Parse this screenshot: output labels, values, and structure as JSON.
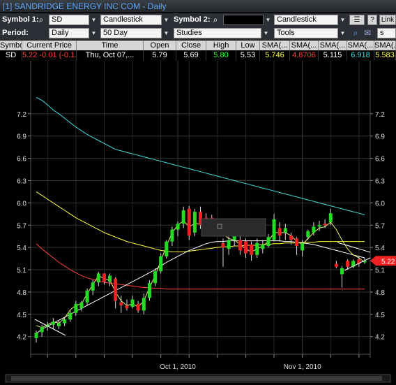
{
  "window": {
    "title": "[1] SANDRIDGE ENERGY INC   COM - Daily"
  },
  "toolbar": {
    "symbol1_label": "Symbol 1:",
    "symbol1_value": "SD",
    "chart_type1": "Candlestick",
    "symbol2_label": "Symbol 2:",
    "symbol2_value": "",
    "chart_type2": "Candlestick",
    "help_label": "?",
    "link_label": "Link",
    "period_label": "Period:",
    "period_value": "Daily",
    "range_value": "50 Day",
    "studies_value": "Studies",
    "tools_value": "Tools",
    "zoom_value": "s"
  },
  "quote": {
    "headers": [
      "Symbol",
      "Current Price",
      "Time",
      "Open",
      "Close",
      "High",
      "Low",
      "SMA(...",
      "SMA(...",
      "SMA(...",
      "SMA(...",
      "SMA(..."
    ],
    "values": [
      "SD",
      "5.22  -0.01  (-0.1...",
      "Thu, Oct 07,...",
      "5.79",
      "5.69",
      "5.80",
      "5.53",
      "5.746",
      "4.8706",
      "5.115",
      "6.918",
      "5.583"
    ],
    "colors": [
      "#ffffff",
      "#ff4040",
      "#ffffff",
      "#ffffff",
      "#ffffff",
      "#30ff30",
      "#ffffff",
      "#ffff40",
      "#ff4040",
      "#ffffff",
      "#40e0e0",
      "#ffff40"
    ]
  },
  "chart_data": {
    "type": "candlestick",
    "y_ticks": [
      "7.2",
      "6.9",
      "6.6",
      "6.3",
      "6.0",
      "5.7",
      "5.4",
      "5.1",
      "4.8",
      "4.5",
      "4.2"
    ],
    "ylim": [
      4.0,
      7.48
    ],
    "x_labels": [
      "Oct 1, 2010",
      "Nov 1, 2010"
    ],
    "x_label_index": [
      25,
      47
    ],
    "price_tag": "5.22",
    "candles": [
      {
        "o": 4.18,
        "h": 4.28,
        "l": 4.12,
        "c": 4.25
      },
      {
        "o": 4.26,
        "h": 4.36,
        "l": 4.2,
        "c": 4.33
      },
      {
        "o": 4.33,
        "h": 4.4,
        "l": 4.28,
        "c": 4.36
      },
      {
        "o": 4.36,
        "h": 4.45,
        "l": 4.3,
        "c": 4.4
      },
      {
        "o": 4.34,
        "h": 4.42,
        "l": 4.3,
        "c": 4.38
      },
      {
        "o": 4.38,
        "h": 4.46,
        "l": 4.34,
        "c": 4.43
      },
      {
        "o": 4.43,
        "h": 4.55,
        "l": 4.4,
        "c": 4.52
      },
      {
        "o": 4.52,
        "h": 4.68,
        "l": 4.48,
        "c": 4.64
      },
      {
        "o": 4.58,
        "h": 4.68,
        "l": 4.54,
        "c": 4.66
      },
      {
        "o": 4.66,
        "h": 4.85,
        "l": 4.62,
        "c": 4.82
      },
      {
        "o": 4.82,
        "h": 4.96,
        "l": 4.76,
        "c": 4.93
      },
      {
        "o": 4.93,
        "h": 5.07,
        "l": 4.88,
        "c": 5.05
      },
      {
        "o": 5.05,
        "h": 4.98,
        "l": 4.9,
        "c": 4.94
      },
      {
        "o": 4.94,
        "h": 5.05,
        "l": 4.88,
        "c": 5.02
      },
      {
        "o": 4.98,
        "h": 5.0,
        "l": 4.58,
        "c": 4.68
      },
      {
        "o": 4.66,
        "h": 4.75,
        "l": 4.52,
        "c": 4.62
      },
      {
        "o": 4.62,
        "h": 4.7,
        "l": 4.55,
        "c": 4.58
      },
      {
        "o": 4.6,
        "h": 4.75,
        "l": 4.58,
        "c": 4.7
      },
      {
        "o": 4.64,
        "h": 4.68,
        "l": 4.52,
        "c": 4.55
      },
      {
        "o": 4.55,
        "h": 4.78,
        "l": 4.5,
        "c": 4.72
      },
      {
        "o": 4.72,
        "h": 4.96,
        "l": 4.68,
        "c": 4.92
      },
      {
        "o": 4.92,
        "h": 5.12,
        "l": 4.88,
        "c": 5.08
      },
      {
        "o": 5.08,
        "h": 5.32,
        "l": 5.05,
        "c": 5.28
      },
      {
        "o": 5.28,
        "h": 5.5,
        "l": 5.25,
        "c": 5.48
      },
      {
        "o": 5.48,
        "h": 5.68,
        "l": 5.42,
        "c": 5.64
      },
      {
        "o": 5.64,
        "h": 5.75,
        "l": 5.55,
        "c": 5.72
      },
      {
        "o": 5.72,
        "h": 5.95,
        "l": 5.66,
        "c": 5.9
      },
      {
        "o": 5.92,
        "h": 5.96,
        "l": 5.5,
        "c": 5.56
      },
      {
        "o": 5.6,
        "h": 5.92,
        "l": 5.55,
        "c": 5.88
      },
      {
        "o": 5.88,
        "h": 5.95,
        "l": 5.65,
        "c": 5.7
      },
      {
        "o": 5.8,
        "h": 5.86,
        "l": 5.68,
        "c": 5.72
      },
      {
        "o": 5.8,
        "h": 5.84,
        "l": 5.66,
        "c": 5.7
      },
      {
        "o": 5.72,
        "h": 5.76,
        "l": 5.6,
        "c": 5.64
      },
      {
        "o": 5.46,
        "h": 5.52,
        "l": 5.14,
        "c": 5.4
      },
      {
        "o": 5.38,
        "h": 5.56,
        "l": 5.3,
        "c": 5.5
      },
      {
        "o": 5.5,
        "h": 5.62,
        "l": 5.42,
        "c": 5.56
      },
      {
        "o": 5.5,
        "h": 5.56,
        "l": 5.3,
        "c": 5.36
      },
      {
        "o": 5.48,
        "h": 5.52,
        "l": 5.26,
        "c": 5.32
      },
      {
        "o": 5.44,
        "h": 5.48,
        "l": 5.22,
        "c": 5.3
      },
      {
        "o": 5.3,
        "h": 5.52,
        "l": 5.26,
        "c": 5.46
      },
      {
        "o": 5.38,
        "h": 5.5,
        "l": 5.32,
        "c": 5.44
      },
      {
        "o": 5.42,
        "h": 5.58,
        "l": 5.4,
        "c": 5.54
      },
      {
        "o": 5.5,
        "h": 5.85,
        "l": 5.48,
        "c": 5.78
      },
      {
        "o": 5.66,
        "h": 5.74,
        "l": 5.48,
        "c": 5.56
      },
      {
        "o": 5.6,
        "h": 5.72,
        "l": 5.5,
        "c": 5.66
      },
      {
        "o": 5.56,
        "h": 5.6,
        "l": 5.44,
        "c": 5.5
      },
      {
        "o": 5.52,
        "h": 5.54,
        "l": 5.3,
        "c": 5.42
      },
      {
        "o": 5.36,
        "h": 5.5,
        "l": 5.28,
        "c": 5.46
      },
      {
        "o": 5.54,
        "h": 5.64,
        "l": 5.5,
        "c": 5.62
      },
      {
        "o": 5.6,
        "h": 5.74,
        "l": 5.56,
        "c": 5.68
      },
      {
        "o": 5.68,
        "h": 5.76,
        "l": 5.62,
        "c": 5.7
      },
      {
        "o": 5.72,
        "h": 5.78,
        "l": 5.66,
        "c": 5.7
      },
      {
        "o": 5.74,
        "h": 5.92,
        "l": 5.7,
        "c": 5.86
      },
      {
        "o": 5.18,
        "h": 5.22,
        "l": 5.12,
        "c": 5.14
      },
      {
        "o": 5.04,
        "h": 5.15,
        "l": 4.86,
        "c": 5.12
      },
      {
        "o": 5.22,
        "h": 5.24,
        "l": 5.1,
        "c": 5.14
      },
      {
        "o": 5.14,
        "h": 5.24,
        "l": 5.12,
        "c": 5.22
      },
      {
        "o": 5.24,
        "h": 5.28,
        "l": 5.14,
        "c": 5.18
      },
      {
        "o": 5.2,
        "h": 5.26,
        "l": 5.18,
        "c": 5.22
      }
    ],
    "series": [
      {
        "color": "#40e0e0",
        "values": [
          7.42,
          7.38,
          7.32,
          7.25,
          7.2,
          7.14,
          7.08,
          7.02,
          6.97,
          6.92,
          6.88,
          6.84,
          6.8,
          6.76,
          6.72,
          6.7,
          6.68,
          6.66,
          6.64,
          6.62,
          6.6,
          6.58,
          6.56,
          6.54,
          6.52,
          6.5,
          6.48,
          6.46,
          6.44,
          6.42,
          6.4,
          6.38,
          6.36,
          6.34,
          6.32,
          6.3,
          6.28,
          6.26,
          6.24,
          6.22,
          6.2,
          6.18,
          6.16,
          6.14,
          6.12,
          6.1,
          6.08,
          6.06,
          6.04,
          6.02,
          6.0,
          5.98,
          5.96,
          5.94,
          5.92,
          5.9,
          5.88,
          5.86,
          5.84
        ]
      },
      {
        "color": "#ffff40",
        "values": [
          6.15,
          6.1,
          6.05,
          6.0,
          5.95,
          5.9,
          5.85,
          5.8,
          5.76,
          5.72,
          5.68,
          5.64,
          5.6,
          5.57,
          5.54,
          5.51,
          5.48,
          5.46,
          5.44,
          5.42,
          5.4,
          5.38,
          5.36,
          5.35,
          5.34,
          5.34,
          5.34,
          5.35,
          5.36,
          5.37,
          5.38,
          5.39,
          5.4,
          5.41,
          5.41,
          5.42,
          5.42,
          5.43,
          5.43,
          5.43,
          5.44,
          5.44,
          5.45,
          5.45,
          5.46,
          5.46,
          5.46,
          5.47,
          5.47,
          5.47,
          5.48,
          5.48,
          5.48,
          5.48,
          5.48,
          5.48,
          5.48,
          5.48,
          5.48
        ]
      },
      {
        "color": "#ff4040",
        "values": [
          5.45,
          5.38,
          5.32,
          5.26,
          5.2,
          5.15,
          5.1,
          5.06,
          5.02,
          4.99,
          4.97,
          4.95,
          4.93,
          4.92,
          4.91,
          4.9,
          4.89,
          4.88,
          4.87,
          4.86,
          4.86,
          4.85,
          4.85,
          4.84,
          4.84,
          4.84,
          4.84,
          4.84,
          4.84,
          4.84,
          4.84,
          4.84,
          4.84,
          4.84,
          4.84,
          4.84,
          4.84,
          4.84,
          4.84,
          4.84,
          4.84,
          4.84,
          4.84,
          4.84,
          4.84,
          4.84,
          4.84,
          4.84,
          4.84,
          4.84,
          4.84,
          4.84,
          4.84,
          4.84,
          4.84,
          4.84,
          4.84,
          4.84,
          4.84
        ]
      },
      {
        "color": "#ffffff",
        "values": [
          4.24,
          4.3,
          4.34,
          4.38,
          4.42,
          4.46,
          4.5,
          4.54,
          4.58,
          4.62,
          4.66,
          4.7,
          4.74,
          4.78,
          4.82,
          4.86,
          4.9,
          4.94,
          4.98,
          5.02,
          5.06,
          5.1,
          5.15,
          5.2,
          5.24,
          5.28,
          5.32,
          5.36,
          5.39,
          5.42,
          5.45,
          5.47,
          5.48,
          5.48,
          5.49,
          5.49,
          5.49,
          5.49,
          5.49,
          5.49,
          5.49,
          5.49,
          5.49,
          5.49,
          5.48,
          5.48,
          5.47,
          5.46,
          5.45,
          5.44,
          5.42,
          5.4,
          5.38,
          5.36,
          5.34,
          5.32,
          5.3,
          5.28,
          5.26
        ]
      },
      {
        "color": "#f0f070",
        "values": [
          4.35,
          4.32,
          4.36,
          4.4,
          4.38,
          4.45,
          4.56,
          4.62,
          4.64,
          4.78,
          4.9,
          5.02,
          4.98,
          4.96,
          4.8,
          4.68,
          4.62,
          4.64,
          4.6,
          4.68,
          4.86,
          5.02,
          5.22,
          5.42,
          5.6,
          5.7,
          5.76,
          5.68,
          5.72,
          5.72,
          5.7,
          5.68,
          5.66,
          5.58,
          5.52,
          5.5,
          5.44,
          5.38,
          5.34,
          5.38,
          5.42,
          5.48,
          5.6,
          5.6,
          5.6,
          5.56,
          5.48,
          5.44,
          5.52,
          5.6,
          5.66,
          5.68,
          5.74,
          5.64,
          5.5,
          5.38,
          5.3,
          5.26,
          5.2
        ]
      }
    ]
  }
}
